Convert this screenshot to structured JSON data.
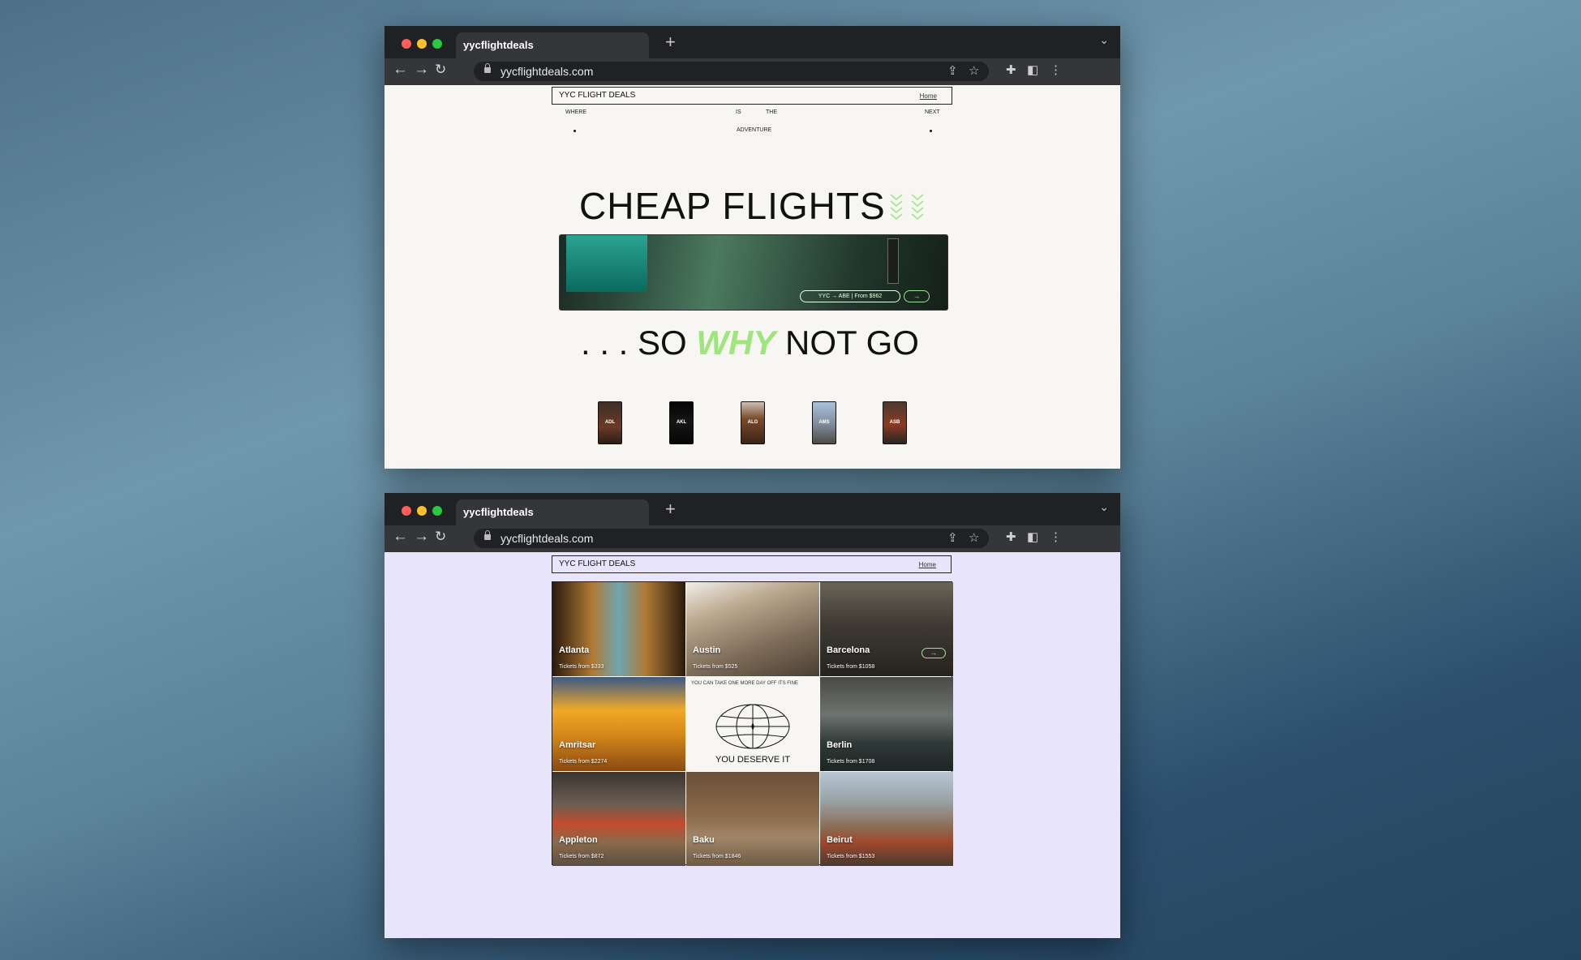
{
  "windows": [
    {
      "tab_title": "yycflightdeals",
      "url": "yycflightdeals.com",
      "site": {
        "brand": "YYC FLIGHT DEALS",
        "home_link": "Home",
        "tagline": [
          "WHERE",
          "IS",
          "THE",
          "NEXT",
          "ADVENTURE"
        ],
        "hero_title": "CHEAP FLIGHTS",
        "hero_pill": "YYC → ABE | From $962",
        "hero_arrow": "→",
        "why_prefix": ". . . SO",
        "why_word": "WHY",
        "why_suffix": "NOT GO",
        "thumbnails": [
          "ADL",
          "AKL",
          "ALG",
          "AMS",
          "ASB"
        ]
      }
    },
    {
      "tab_title": "yycflightdeals",
      "url": "yycflightdeals.com",
      "site": {
        "brand": "YYC FLIGHT DEALS",
        "home_link": "Home",
        "cards": [
          {
            "city": "Atlanta",
            "price": "Tickets from $333"
          },
          {
            "city": "Austin",
            "price": "Tickets from $525"
          },
          {
            "city": "Barcelona",
            "price": "Tickets from $1058",
            "arrow": "→"
          },
          {
            "city": "Amritsar",
            "price": "Tickets from $2274"
          },
          {
            "city": "Berlin",
            "price": "Tickets from $1708"
          },
          {
            "city": "Appleton",
            "price": "Tickets from $872"
          },
          {
            "city": "Baku",
            "price": "Tickets from $1846"
          },
          {
            "city": "Beirut",
            "price": "Tickets from $1553"
          }
        ],
        "promo_top": "YOU CAN TAKE ONE MORE DAY OFF ITS FINE",
        "promo_bottom": "YOU DESERVE IT"
      }
    }
  ],
  "colors": {
    "accent_green": "#9ee57e",
    "traffic_red": "#ff5f57",
    "traffic_yellow": "#febc2e",
    "traffic_green": "#28c840"
  }
}
